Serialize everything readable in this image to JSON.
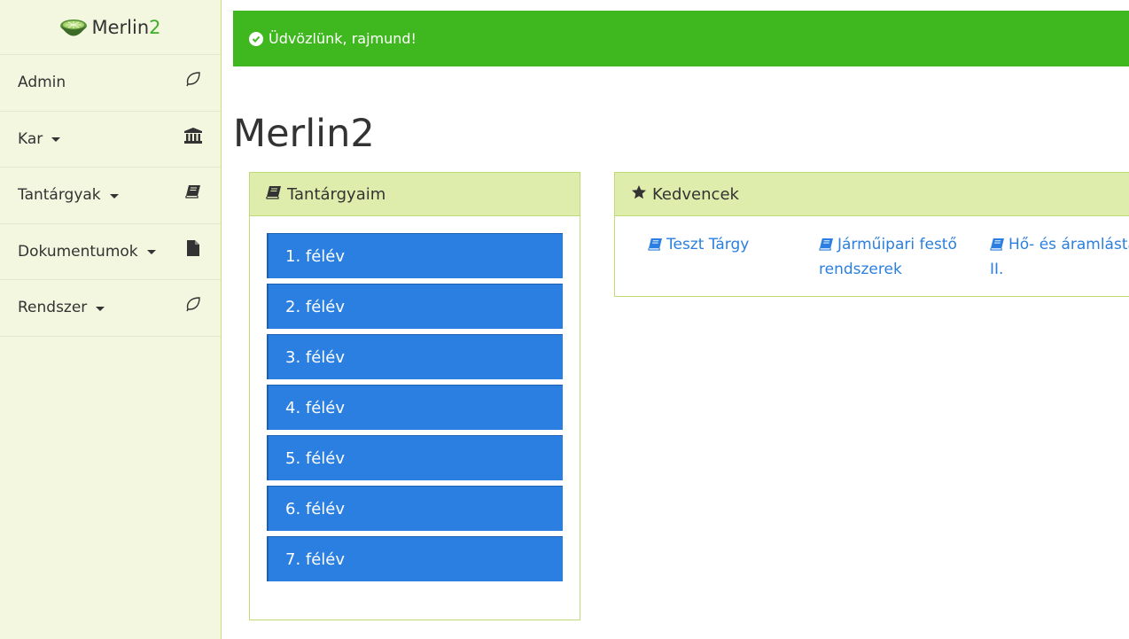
{
  "sidebar": {
    "brand": {
      "name": "Merlin",
      "accent": "2"
    },
    "items": [
      {
        "label": "Admin",
        "has_caret": false,
        "icon": "leaf-icon"
      },
      {
        "label": "Kar",
        "has_caret": true,
        "icon": "institution-icon"
      },
      {
        "label": "Tantárgyak",
        "has_caret": true,
        "icon": "book-icon"
      },
      {
        "label": "Dokumentumok",
        "has_caret": true,
        "icon": "file-icon"
      },
      {
        "label": "Rendszer",
        "has_caret": true,
        "icon": "leaf-icon"
      }
    ]
  },
  "alert": {
    "text": "Üdvözlünk, rajmund!",
    "icon": "check-circle-icon"
  },
  "page_title": "Merlin2",
  "subjects_panel": {
    "title": "Tantárgyaim",
    "icon": "book-icon",
    "semesters": [
      "1. félév",
      "2. félév",
      "3. félév",
      "4. félév",
      "5. félév",
      "6. félév",
      "7. félév"
    ]
  },
  "favorites_panel": {
    "title": "Kedvencek",
    "icon": "star-icon",
    "items": [
      "Teszt Tárgy",
      "Járműipari festő rendszerek",
      "Hő- és áramlástan II."
    ]
  },
  "colors": {
    "sidebar_bg": "#f3f7df",
    "alert_bg": "#3fb81f",
    "panel_heading_bg": "#deedab",
    "semester_bg": "#2a7fe0",
    "link": "#2a7fe0",
    "brand_accent": "#3fae29"
  }
}
